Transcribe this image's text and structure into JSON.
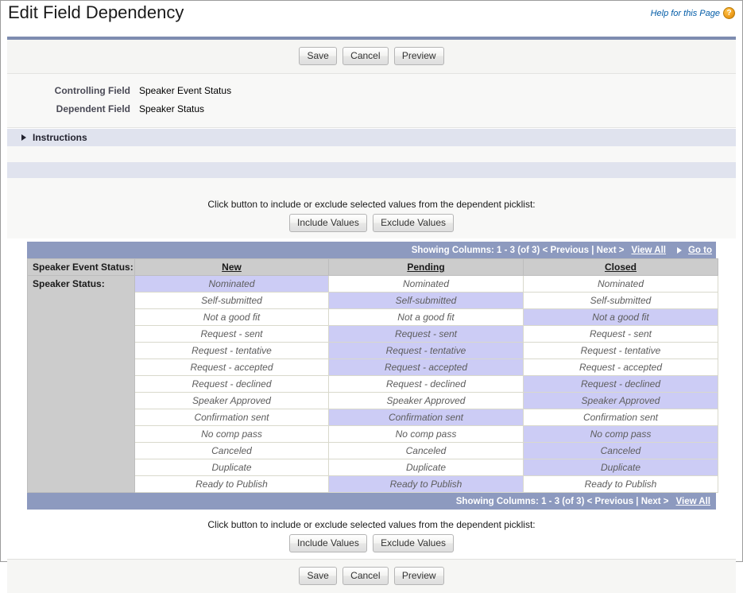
{
  "header": {
    "title": "Edit Field Dependency",
    "help_label": "Help for this Page",
    "help_icon": "question-mark-circle-icon"
  },
  "toolbar": {
    "save_label": "Save",
    "cancel_label": "Cancel",
    "preview_label": "Preview"
  },
  "fields": {
    "controlling_label": "Controlling Field",
    "controlling_value": "Speaker Event Status",
    "dependent_label": "Dependent Field",
    "dependent_value": "Speaker Status"
  },
  "instructions": {
    "title": "Instructions",
    "twisty_icon": "triangle-right-icon"
  },
  "include_exclude": {
    "hint": "Click button to include or exclude selected values from the dependent picklist:",
    "include_label": "Include Values",
    "exclude_label": "Exclude Values"
  },
  "pagination_top": {
    "showing_text": "Showing Columns: 1 - 3 (of 3) < Previous | Next >",
    "view_all_label": "View All",
    "goto_label": "Go to",
    "goto_arrow_icon": "triangle-right-icon"
  },
  "pagination_bottom": {
    "showing_text": "Showing Columns: 1 - 3 (of 3) < Previous | Next >",
    "view_all_label": "View All"
  },
  "matrix": {
    "controlling_row_label": "Speaker Event Status:",
    "dependent_row_label": "Speaker Status:",
    "columns": [
      "New",
      "Pending",
      "Closed"
    ],
    "rows": [
      "Nominated",
      "Self-submitted",
      "Not a good fit",
      "Request - sent",
      "Request - tentative",
      "Request - accepted",
      "Request - declined",
      "Speaker Approved",
      "Confirmation sent",
      "No comp pass",
      "Canceled",
      "Duplicate",
      "Ready to Publish"
    ],
    "selected": [
      [
        true,
        false,
        false
      ],
      [
        false,
        true,
        false
      ],
      [
        false,
        false,
        true
      ],
      [
        false,
        true,
        false
      ],
      [
        false,
        true,
        false
      ],
      [
        false,
        true,
        false
      ],
      [
        false,
        false,
        true
      ],
      [
        false,
        false,
        true
      ],
      [
        false,
        true,
        false
      ],
      [
        false,
        false,
        true
      ],
      [
        false,
        false,
        true
      ],
      [
        false,
        false,
        true
      ],
      [
        false,
        true,
        false
      ]
    ]
  },
  "colors": {
    "selected_cell": "#ccccf5",
    "header_bar": "#8d9abf",
    "column_header": "#cccccc",
    "section_bar": "#e0e3ee",
    "link": "#015ba7",
    "help_icon": "#f0a01e"
  }
}
